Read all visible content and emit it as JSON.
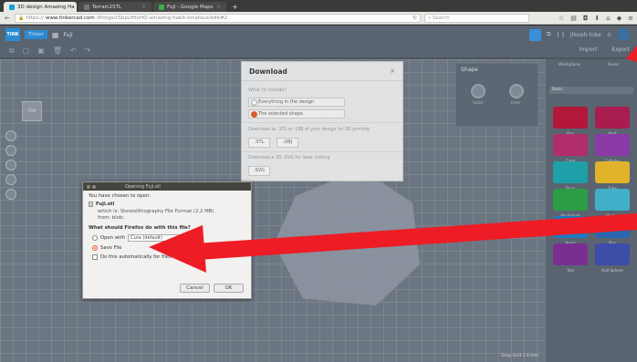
{
  "browser": {
    "tabs": [
      {
        "label": "3D design Amazing Ha"
      },
      {
        "label": "Terrain2STL"
      },
      {
        "label": "Fuji - Google Maps"
      }
    ],
    "url_host": "www.tinkercad.com",
    "url_rest": "/things/cSbpuHtoHQ-amazing-habit-kinatous/edit#2",
    "url_prefix": "https://",
    "search_placeholder": "Search"
  },
  "app": {
    "logo_text": "TINK",
    "badge_text": "Tinker",
    "design_name": "Fuji",
    "top_right": {
      "menu_label": "Jtkoeh-toke"
    },
    "toolbar_right": {
      "import_label": "Import",
      "export_label": "Export"
    },
    "viewcube_label": "TOP",
    "snap_grid_label": "Snap Grid  1.0 mm"
  },
  "inspector": {
    "title": "Shape",
    "hole_label": "Solid",
    "solid_label": "Hole"
  },
  "shapes_panel": {
    "head_labels": [
      "Workplane",
      "Ruler"
    ],
    "category": "Basic",
    "items": [
      {
        "label": "Box",
        "color": "#b3173a"
      },
      {
        "label": "Roof",
        "color": "#a81c4f"
      },
      {
        "label": "Cone",
        "color": "#b02e6a"
      },
      {
        "label": "Cylinder",
        "color": "#8b3aa8"
      },
      {
        "label": "Torus",
        "color": "#1fa0a8"
      },
      {
        "label": "Tube",
        "color": "#e1b32b"
      },
      {
        "label": "Paraboloid",
        "color": "#2d9c46"
      },
      {
        "label": "Wedge",
        "color": "#40b0c8"
      },
      {
        "label": "Heart",
        "color": "#1a7ac4"
      },
      {
        "label": "Star",
        "color": "#2a66b0"
      },
      {
        "label": "Text",
        "color": "#7a2e92"
      },
      {
        "label": "Half Sphere",
        "color": "#3d4da8"
      }
    ]
  },
  "download_dialog": {
    "title": "Download",
    "question": "What to include?",
    "option_all": "Everything in the design",
    "option_selected": "The selected shape.",
    "print_hint": "Download as .STL or .OBJ of your design for 3D printing",
    "stl_label": ".STL",
    "obj_label": ".OBJ",
    "cut_hint": "Download a 2D .SVG for laser cutting",
    "svg_label": ".SVG"
  },
  "file_dialog": {
    "title": "Opening Fuji.stl",
    "intro": "You have chosen to open:",
    "filename": "Fuji.stl",
    "which_is": "which is: Stereolithography File Format (2.2 MB)",
    "from": "from: blob:",
    "question": "What should Firefox do with this file?",
    "open_with_label": "Open with",
    "open_with_value": "Cura (default)",
    "save_file_label": "Save File",
    "auto_label": "Do this automatically for files like this from now on.",
    "cancel_label": "Cancel",
    "ok_label": "OK"
  },
  "colors": {
    "arrow_red": "#ee1c25",
    "accent_orange": "#e4582a",
    "accent_blue": "#2a8bd2"
  }
}
